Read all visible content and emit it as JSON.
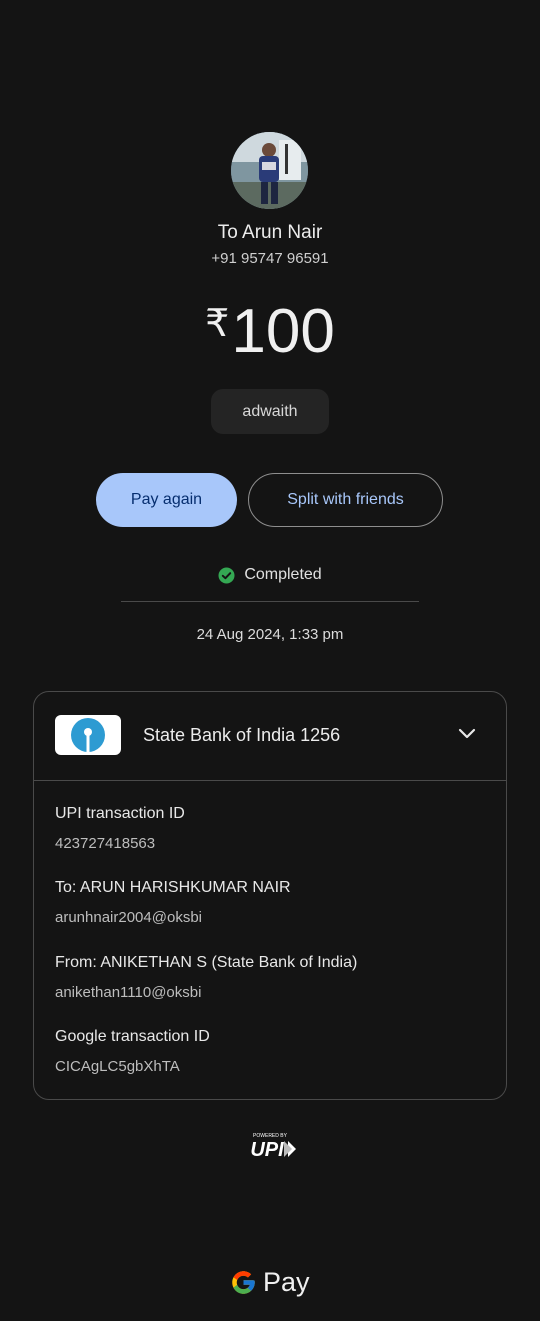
{
  "payee": {
    "to_label": "To Arun Nair",
    "phone": "+91 95747 96591"
  },
  "payment": {
    "currency_symbol": "₹",
    "amount": "100",
    "note": "adwaith"
  },
  "actions": {
    "pay_again": "Pay again",
    "split": "Split with friends"
  },
  "status": {
    "text": "Completed",
    "datetime": "24 Aug 2024, 1:33 pm",
    "color": "#34a853"
  },
  "bank": {
    "name": "State Bank of India 1256",
    "logo_color": "#2d9bd2"
  },
  "details": {
    "upi_label": "UPI transaction ID",
    "upi_value": "423727418563",
    "to_label": "To: ARUN HARISHKUMAR NAIR",
    "to_value": "arunhnair2004@oksbi",
    "from_label": "From: ANIKETHAN  S (State Bank of India)",
    "from_value": "anikethan1110@oksbi",
    "google_label": "Google transaction ID",
    "google_value": "CICAgLC5gbXhTA"
  },
  "footer": {
    "upi_powered": "POWERED BY",
    "upi_mark": "UPI",
    "pay_text": "Pay"
  },
  "icons": {
    "status": "check-circle-icon",
    "expand": "chevron-down-icon"
  }
}
